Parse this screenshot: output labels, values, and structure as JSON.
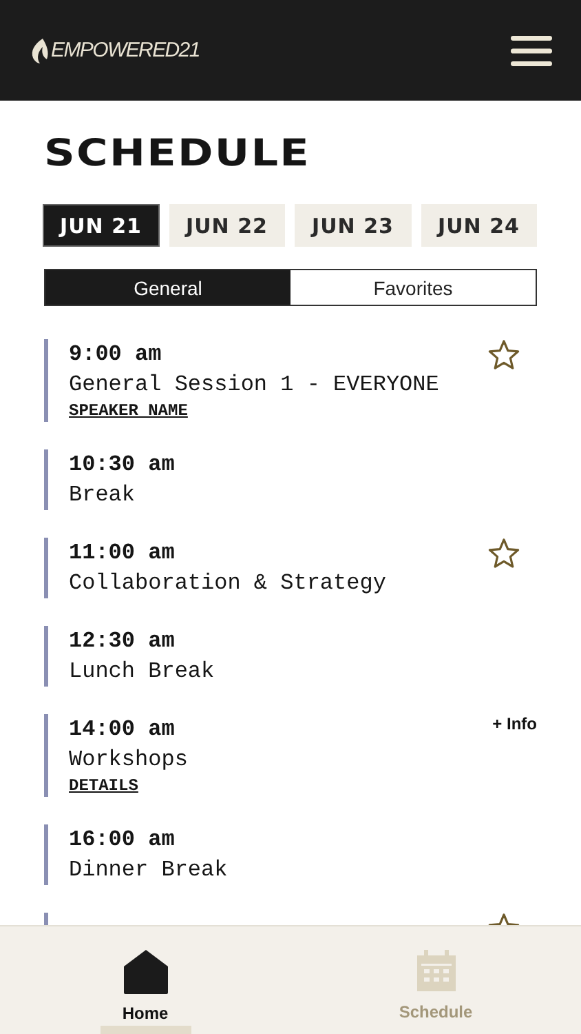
{
  "header": {
    "logo": "EMPOWERED21"
  },
  "title": "SCHEDULE",
  "dates": [
    {
      "label": "JUN 21",
      "selected": true
    },
    {
      "label": "JUN 22",
      "selected": false
    },
    {
      "label": "JUN 23",
      "selected": false
    },
    {
      "label": "JUN 24",
      "selected": false
    }
  ],
  "segments": [
    {
      "label": "General",
      "selected": true
    },
    {
      "label": "Favorites",
      "selected": false
    }
  ],
  "sessions": [
    {
      "time": "9:00 am",
      "title": "General Session 1 - EVERYONE",
      "link": "SPEAKER NAME",
      "kind": "star",
      "favorite": false
    },
    {
      "time": "10:30 am",
      "title": "Break",
      "kind": "plain"
    },
    {
      "time": "11:00 am",
      "title": "Collaboration & Strategy",
      "kind": "star",
      "favorite": false
    },
    {
      "time": "12:30 am",
      "title": "Lunch Break",
      "kind": "plain"
    },
    {
      "time": "14:00 am",
      "title": "Workshops",
      "link": "DETAILS",
      "kind": "info",
      "info": "+ Info"
    },
    {
      "time": "16:00 am",
      "title": "Dinner Break",
      "kind": "plain"
    },
    {
      "kind": "star",
      "favorite": false
    }
  ],
  "nav": [
    {
      "label": "Home",
      "kind": "home",
      "selected": true
    },
    {
      "label": "Schedule",
      "kind": "calendar",
      "selected": false
    }
  ]
}
